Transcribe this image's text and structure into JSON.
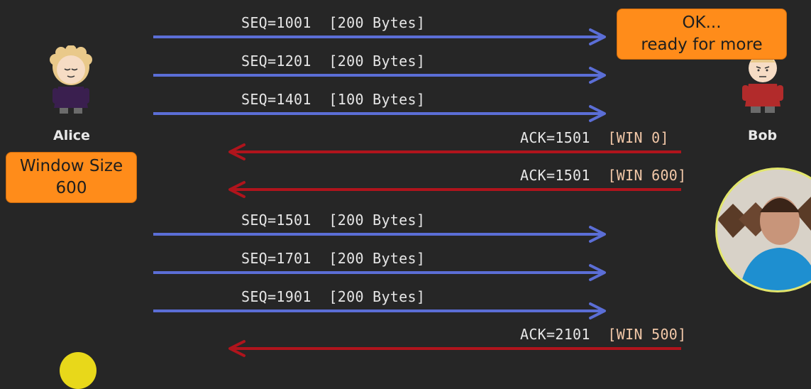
{
  "participants": {
    "left_name": "Alice",
    "right_name": "Bob"
  },
  "alice_callout": {
    "line1": "Window Size",
    "line2": "600"
  },
  "bob_callout": {
    "line1": "OK...",
    "line2": "ready for more"
  },
  "messages": [
    {
      "direction": "right",
      "label": "SEQ=1001",
      "bracket": "[200 Bytes]"
    },
    {
      "direction": "right",
      "label": "SEQ=1201",
      "bracket": "[200 Bytes]"
    },
    {
      "direction": "right",
      "label": "SEQ=1401",
      "bracket": "[100 Bytes]"
    },
    {
      "direction": "left",
      "label": "ACK=1501",
      "bracket": "[WIN 0]"
    },
    {
      "direction": "left",
      "label": "ACK=1501",
      "bracket": "[WIN 600]"
    },
    {
      "direction": "right",
      "label": "SEQ=1501",
      "bracket": "[200 Bytes]"
    },
    {
      "direction": "right",
      "label": "SEQ=1701",
      "bracket": "[200 Bytes]"
    },
    {
      "direction": "right",
      "label": "SEQ=1901",
      "bracket": "[200 Bytes]"
    },
    {
      "direction": "left",
      "label": "ACK=2101",
      "bracket": "[WIN 500]"
    }
  ],
  "colors": {
    "background": "#262626",
    "seq_arrow": "#5b6ed6",
    "ack_arrow": "#b0141c",
    "callout": "#ff8c1a",
    "win_text": "#f2c8a8"
  },
  "icons": {
    "alice": "alice-avatar-icon",
    "bob": "bob-avatar-icon",
    "presenter": "presenter-webcam"
  }
}
